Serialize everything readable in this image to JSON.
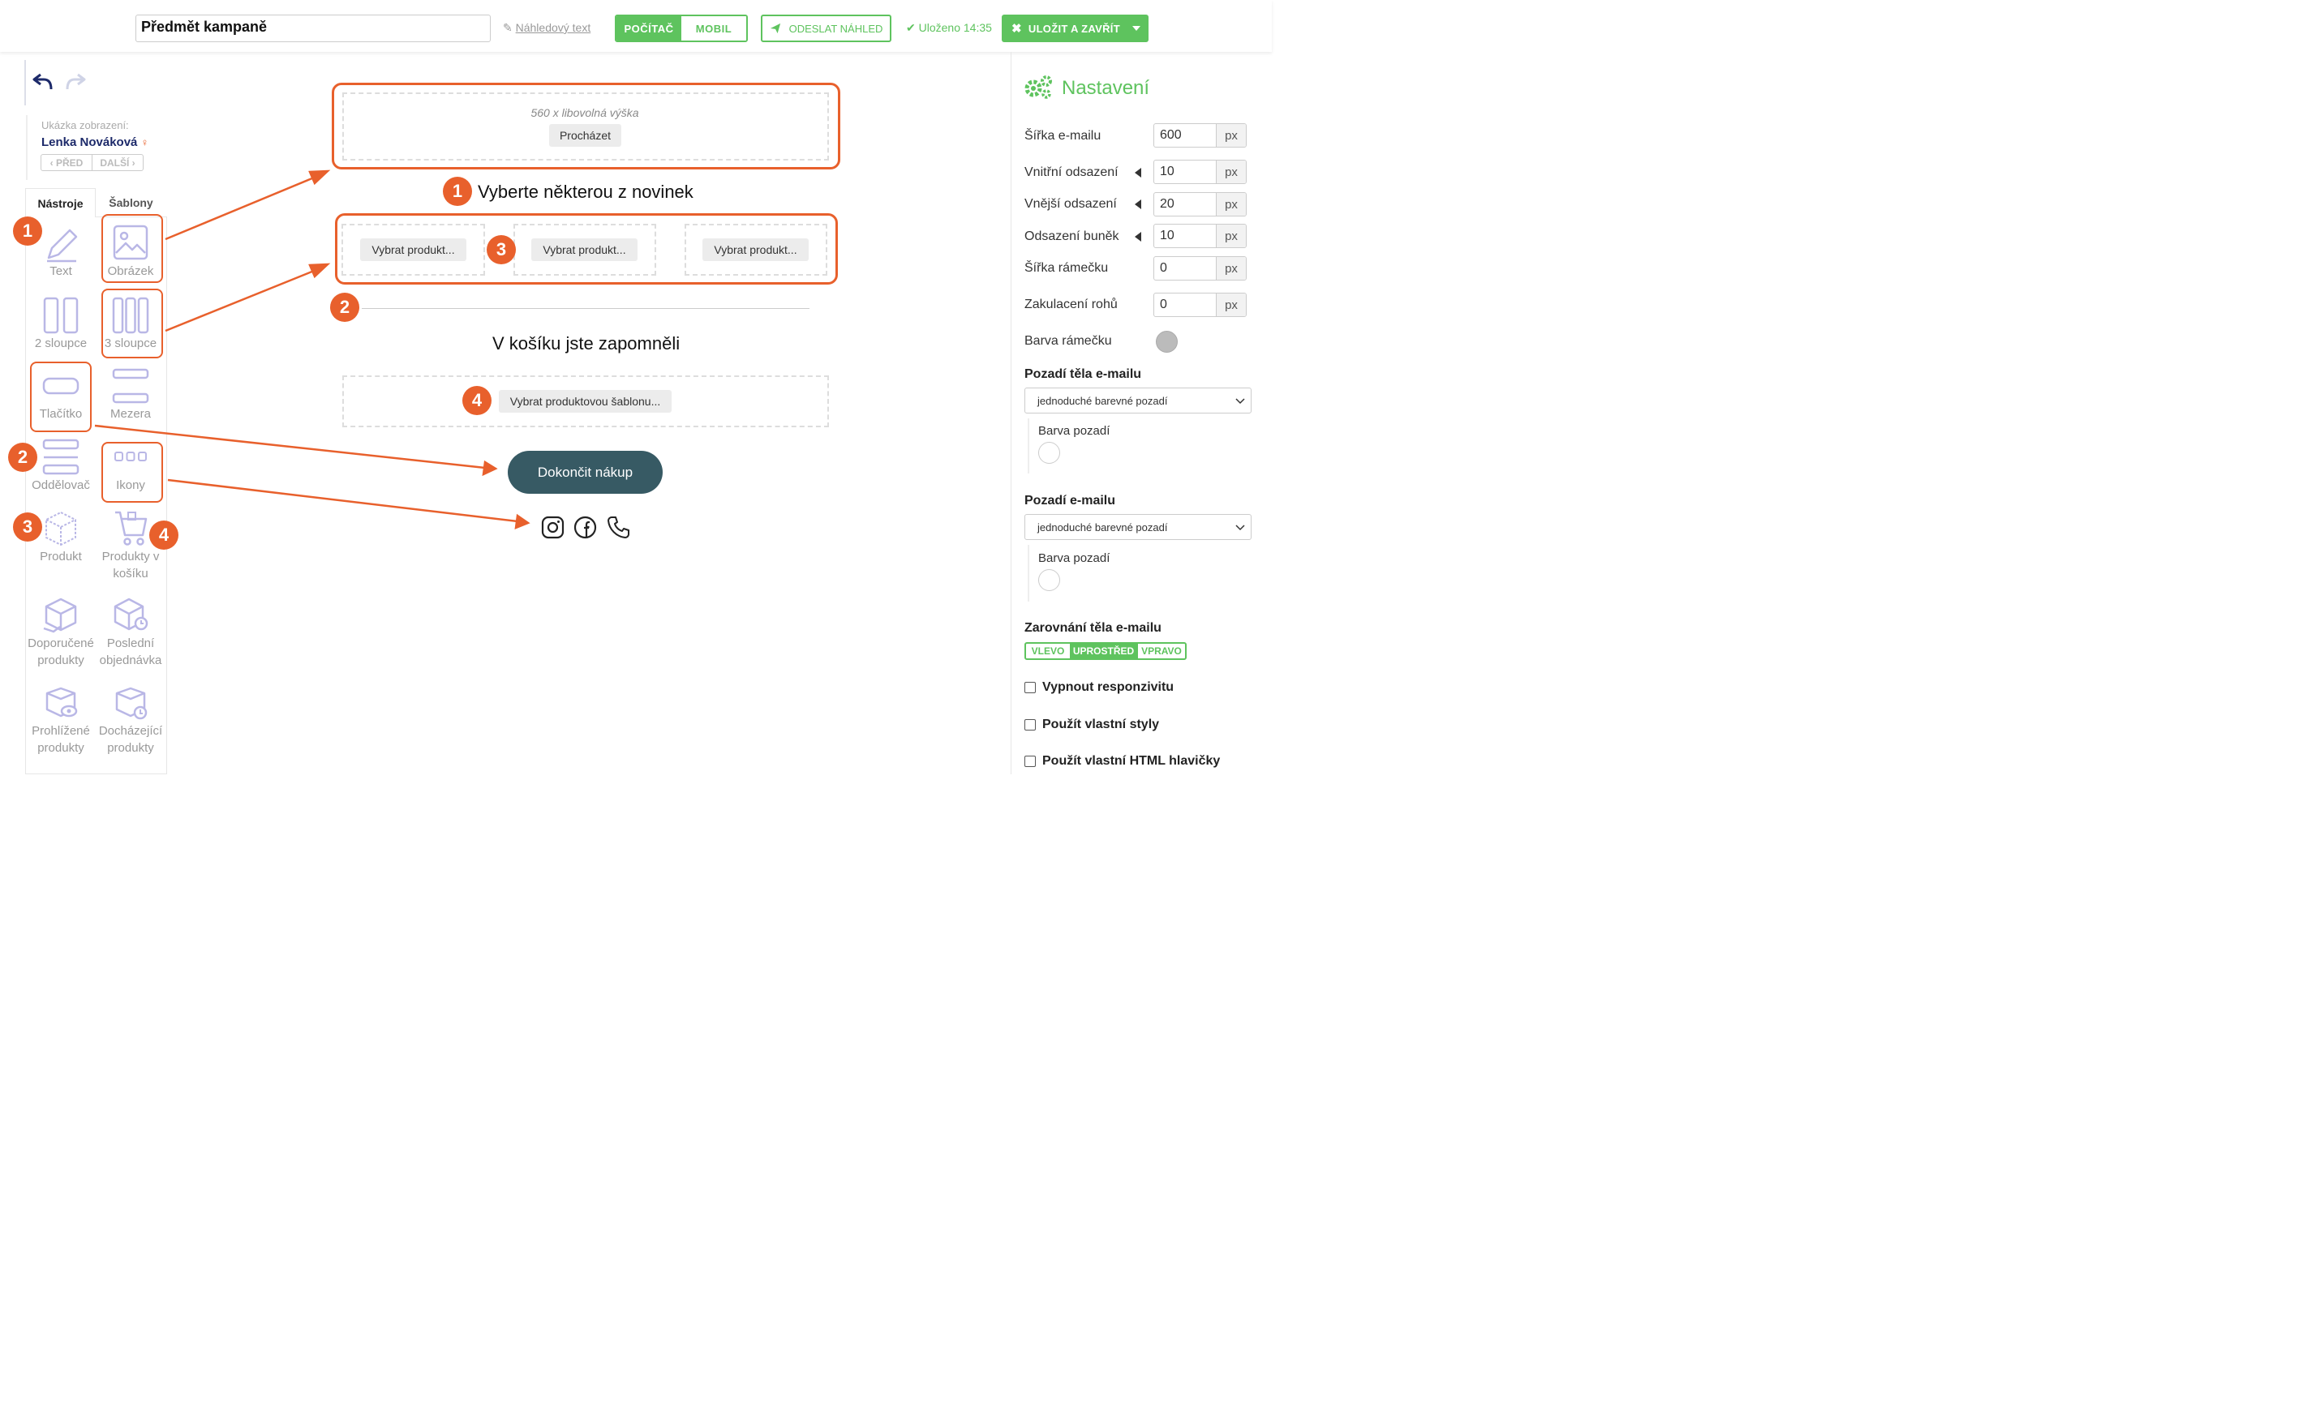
{
  "topbar": {
    "subject_value": "Předmět kampaně",
    "preview_text_label": "Náhledový text",
    "device_desktop": "POČÍTAČ",
    "device_mobile": "MOBIL",
    "send_preview": "ODESLAT NÁHLED",
    "saved_status": "Uloženo 14:35",
    "save_close": "ULOŽIT A ZAVŘÍT"
  },
  "preview": {
    "label": "Ukázka zobrazení:",
    "name": "Lenka Nováková",
    "prev": "PŘED",
    "next": "DALŠÍ"
  },
  "tabs": {
    "tools": "Nástroje",
    "templates": "Šablony"
  },
  "tools": [
    {
      "label": "Text",
      "icon": "pencil-icon"
    },
    {
      "label": "Obrázek",
      "icon": "image-icon"
    },
    {
      "label": "2 sloupce",
      "icon": "two-columns-icon"
    },
    {
      "label": "3 sloupce",
      "icon": "three-columns-icon"
    },
    {
      "label": "Tlačítko",
      "icon": "button-icon"
    },
    {
      "label": "Mezera",
      "icon": "spacer-icon"
    },
    {
      "label": "Oddělovač",
      "icon": "divider-icon"
    },
    {
      "label": "Ikony",
      "icon": "icons-icon"
    },
    {
      "label": "Produkt",
      "icon": "box-icon"
    },
    {
      "label": "Produkty v košíku",
      "icon": "cart-icon"
    },
    {
      "label": "Doporučené produkty",
      "icon": "recommended-box-icon"
    },
    {
      "label": "Poslední objednávka",
      "icon": "last-order-box-icon"
    },
    {
      "label": "Prohlížené produkty",
      "icon": "viewed-box-icon"
    },
    {
      "label": "Docházející produkty",
      "icon": "running-out-box-icon"
    }
  ],
  "badges": {
    "b1": "1",
    "b2": "2",
    "b3": "3",
    "b4": "4"
  },
  "canvas": {
    "image_hint": "560 x libovolná výška",
    "browse": "Procházet",
    "heading1": "Vyberte některou z novinek",
    "select_product": "Vybrat produkt...",
    "heading2": "V košíku jste zapomněli",
    "select_template": "Vybrat produktovou šablonu...",
    "cta": "Dokončit nákup",
    "social_icons": [
      "instagram-icon",
      "facebook-icon",
      "phone-icon"
    ]
  },
  "settings": {
    "title": "Nastavení",
    "rows": [
      {
        "label": "Šířka e-mailu",
        "value": "600",
        "unit": "px"
      },
      {
        "label": "Vnitřní odsazení",
        "value": "10",
        "unit": "px"
      },
      {
        "label": "Vnější odsazení",
        "value": "20",
        "unit": "px"
      },
      {
        "label": "Odsazení buněk",
        "value": "10",
        "unit": "px"
      },
      {
        "label": "Šířka rámečku",
        "value": "0",
        "unit": "px"
      },
      {
        "label": "Zakulacení rohů",
        "value": "0",
        "unit": "px"
      }
    ],
    "border_color_label": "Barva rámečku",
    "body_bg_title": "Pozadí těla e-mailu",
    "body_bg_select": "jednoduché barevné pozadí",
    "body_bg_color_label": "Barva pozadí",
    "email_bg_title": "Pozadí e-mailu",
    "email_bg_select": "jednoduché barevné pozadí",
    "email_bg_color_label": "Barva pozadí",
    "align_title": "Zarovnání těla e-mailu",
    "align_left": "VLEVO",
    "align_center": "UPROSTŘED",
    "align_right": "VPRAVO",
    "cb_responsive": "Vypnout responzivitu",
    "cb_styles": "Použít vlastní styly",
    "cb_html_head": "Použít vlastní HTML hlavičky"
  },
  "colors": {
    "accent": "#5ec35e",
    "highlight": "#e8602c",
    "cta": "#375a64",
    "navy": "#1d2a6a"
  }
}
